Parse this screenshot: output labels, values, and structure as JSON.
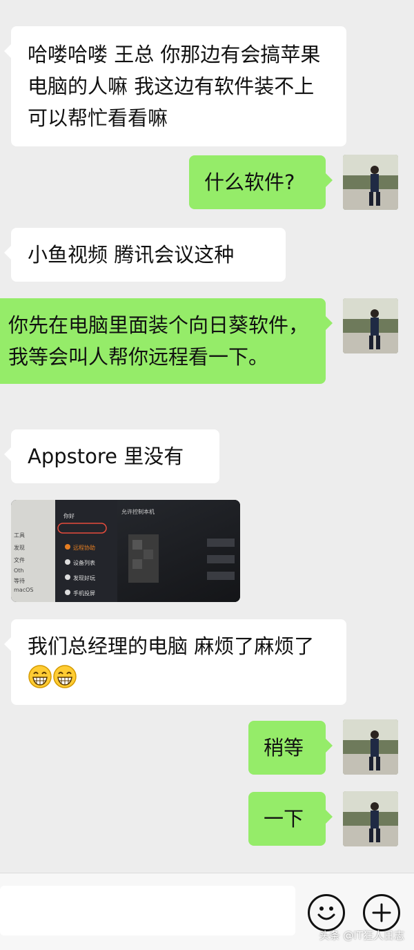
{
  "chat": {
    "messages": [
      {
        "side": "left",
        "type": "text",
        "text": "哈喽哈喽 王总 你那边有会搞苹果电脑的人嘛  我这边有软件装不上 可以帮忙看看嘛"
      },
      {
        "side": "right",
        "type": "text",
        "text": "什么软件?"
      },
      {
        "side": "left",
        "type": "text",
        "text": "小鱼视频 腾讯会议这种"
      },
      {
        "side": "right",
        "type": "text",
        "text": "你先在电脑里面装个向日葵软件，我等会叫人帮你远程看一下。"
      },
      {
        "side": "left",
        "type": "text",
        "text": "Appstore 里没有"
      },
      {
        "side": "left",
        "type": "image",
        "caption": "photo of screen"
      },
      {
        "side": "left",
        "type": "text",
        "text": "我们总经理的电脑 麻烦了麻烦了",
        "emoji": [
          "grin",
          "grin"
        ]
      },
      {
        "side": "right",
        "type": "text",
        "text": "稍等"
      },
      {
        "side": "right",
        "type": "text",
        "text": "一下"
      }
    ]
  },
  "screenshot": {
    "sidebar": [
      "工具",
      "发现",
      "文件",
      "Oth",
      "等待",
      "macOS"
    ],
    "menu": [
      "你好",
      "远程协助",
      "设备列表",
      "发现好玩",
      "手机投屏"
    ],
    "title": "允许控制本机"
  },
  "input_bar": {
    "emoji_icon": "smile-icon",
    "plus_icon": "plus-icon"
  },
  "watermark": "头条 @IT狂人日志",
  "colors": {
    "background": "#ededed",
    "self_bubble": "#95ec69",
    "other_bubble": "#ffffff"
  }
}
